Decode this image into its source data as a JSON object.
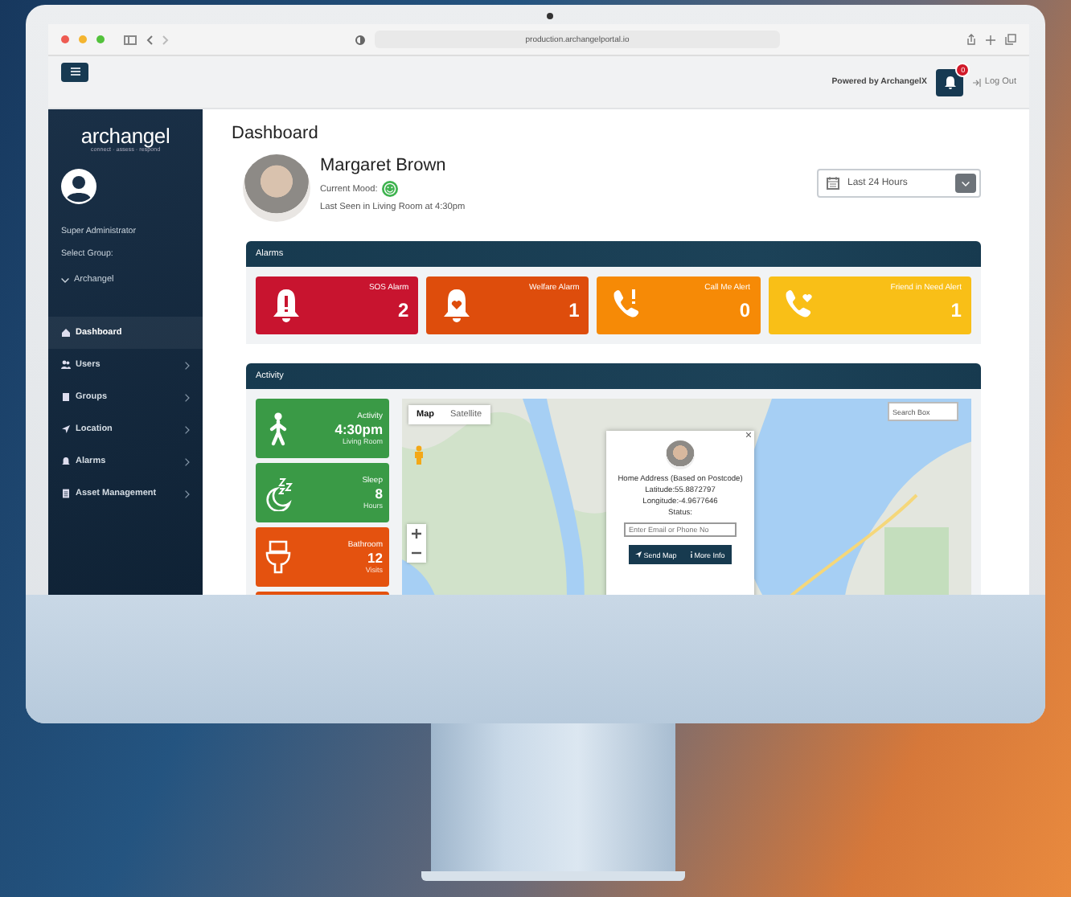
{
  "browser": {
    "url": "production.archangelportal.io"
  },
  "header": {
    "powered_by": "Powered by ArchangelX",
    "notification_count": "0",
    "logout": "Log Out"
  },
  "sidebar": {
    "brand": "archangel",
    "tagline": "connect · assess · respond",
    "role": "Super Administrator",
    "group_label": "Select Group:",
    "group": "Archangel",
    "items": [
      {
        "label": "Dashboard",
        "selected": true,
        "expandable": false
      },
      {
        "label": "Users",
        "selected": false,
        "expandable": true
      },
      {
        "label": "Groups",
        "selected": false,
        "expandable": true
      },
      {
        "label": "Location",
        "selected": false,
        "expandable": true
      },
      {
        "label": "Alarms",
        "selected": false,
        "expandable": true
      },
      {
        "label": "Asset Management",
        "selected": false,
        "expandable": true
      }
    ]
  },
  "main": {
    "title": "Dashboard",
    "person": {
      "name": "Margaret Brown",
      "mood_label": "Current Mood:",
      "last_seen": "Last Seen in Living Room at 4:30pm"
    },
    "date_range": "Last 24 Hours",
    "alarms": {
      "title": "Alarms",
      "cards": [
        {
          "label": "SOS Alarm",
          "count": "2",
          "color": "#c8142f"
        },
        {
          "label": "Welfare Alarm",
          "count": "1",
          "color": "#de4d0c"
        },
        {
          "label": "Call Me Alert",
          "count": "0",
          "color": "#f68a06"
        },
        {
          "label": "Friend in Need Alert",
          "count": "1",
          "color": "#f9bf17"
        }
      ]
    },
    "activity": {
      "title": "Activity",
      "cards": [
        {
          "label": "Activity",
          "value": "4:30pm",
          "note": "Living Room",
          "color": "#3a9a46"
        },
        {
          "label": "Sleep",
          "value": "8",
          "note": "Hours",
          "color": "#3a9a46"
        },
        {
          "label": "Bathroom",
          "value": "12",
          "note": "Visits",
          "color": "#e4520f"
        },
        {
          "color": "#e4520f"
        }
      ]
    },
    "map": {
      "tabs": [
        {
          "label": "Map",
          "selected": true
        },
        {
          "label": "Satellite",
          "selected": false
        }
      ],
      "search_placeholder": "Search Box",
      "popup": {
        "address": "Home Address (Based on Postcode)",
        "latitude": "Latitude:55.8872797",
        "longitude": "Longitude:-4.9677646",
        "status": "Status:",
        "input_placeholder": "Enter Email or Phone No",
        "send": "Send Map",
        "more": "More Info"
      }
    }
  }
}
